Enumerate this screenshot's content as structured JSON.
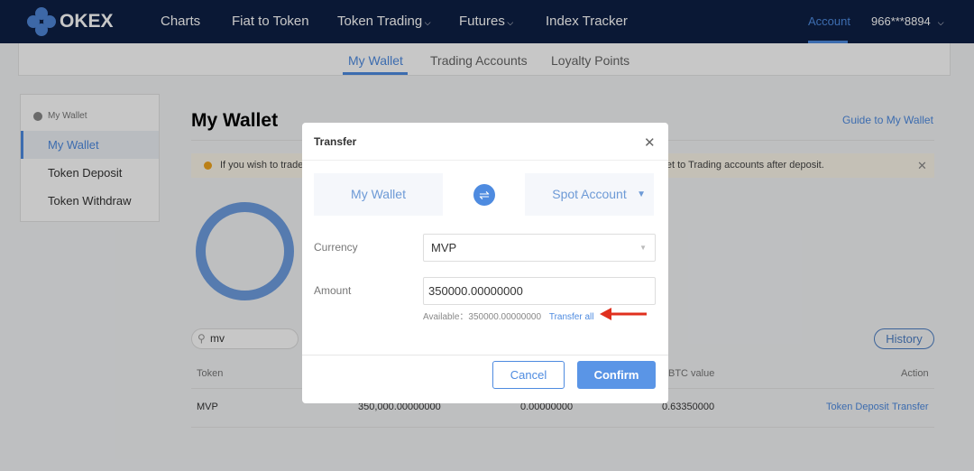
{
  "nav": {
    "logo": "OKEX",
    "items": [
      "Charts",
      "Fiat to Token",
      "Token Trading",
      "Futures",
      "Index Tracker"
    ],
    "account": "Account",
    "user": "966***8894"
  },
  "subnav": {
    "tabs": [
      "My Wallet",
      "Trading Accounts",
      "Loyalty Points"
    ],
    "active": 0
  },
  "sidebar": {
    "heading": "My Wallet",
    "items": [
      "My Wallet",
      "Token Deposit",
      "Token Withdraw"
    ],
    "active": 0
  },
  "main": {
    "title": "My Wallet",
    "guide_link": "Guide to My Wallet",
    "notice_left": "If you wish to trade",
    "notice_right": "llet to Trading accounts after deposit.",
    "search_value": "mv",
    "history": "History",
    "table": {
      "headers": {
        "token": "Token",
        "btc": "BTC value",
        "action": "Action"
      },
      "rows": [
        {
          "token": "MVP",
          "total": "350,000.00000000",
          "frozen": "0.00000000",
          "btc": "0.63350000",
          "actions": [
            "Token Deposit",
            "Transfer"
          ]
        }
      ]
    }
  },
  "modal": {
    "title": "Transfer",
    "from": "My Wallet",
    "to": "Spot Account",
    "currency_label": "Currency",
    "currency": "MVP",
    "amount_label": "Amount",
    "amount": "350000.00000000",
    "available_label": "Available：",
    "available": "350000.00000000",
    "transfer_all": "Transfer all",
    "cancel": "Cancel",
    "confirm": "Confirm"
  },
  "colors": {
    "accent": "#4e8be0",
    "nav_bg": "#0e1f44",
    "arrow": "#e0301e"
  }
}
